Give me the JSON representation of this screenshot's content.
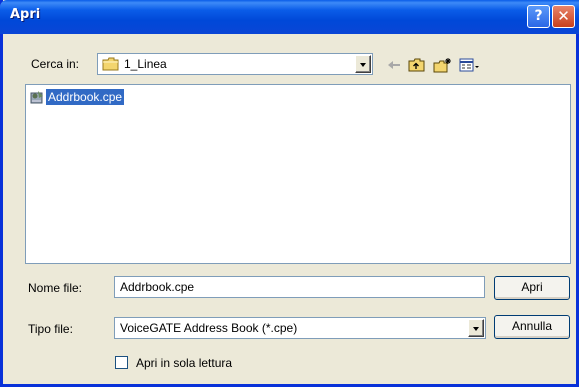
{
  "window": {
    "title": "Apri",
    "help_glyph": "?",
    "close_glyph": "✕"
  },
  "lookin": {
    "label": "Cerca in:",
    "folder": "1_Linea"
  },
  "toolbar": {
    "icons": [
      "back-arrow-icon",
      "up-folder-icon",
      "new-folder-icon",
      "view-menu-icon"
    ]
  },
  "files": [
    {
      "name": "Addrbook.cpe",
      "icon": "address-book-file-icon",
      "selected": true
    }
  ],
  "filename": {
    "label": "Nome file:",
    "value": "Addrbook.cpe"
  },
  "filetype": {
    "label": "Tipo file:",
    "value": "VoiceGATE Address Book (*.cpe)"
  },
  "buttons": {
    "open": "Apri",
    "cancel": "Annulla"
  },
  "readonly": {
    "label": "Apri in sola lettura",
    "checked": false
  },
  "colors": {
    "title_blue": "#0a5ce8",
    "selection": "#316ac5",
    "dialog_face": "#ece9d8"
  }
}
